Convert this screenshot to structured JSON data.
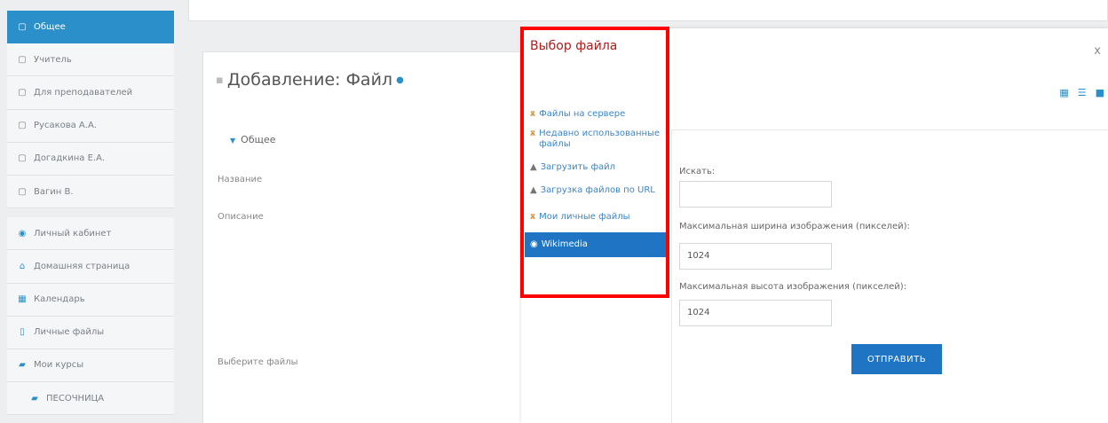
{
  "sidebar": {
    "items": [
      {
        "label": "Общее"
      },
      {
        "label": "Учитель"
      },
      {
        "label": "Для преподавателей"
      },
      {
        "label": "Русакова А.А."
      },
      {
        "label": "Догадкина Е.А."
      },
      {
        "label": "Вагин В."
      },
      {
        "label": "Личный кабинет"
      },
      {
        "label": "Домашняя страница"
      },
      {
        "label": "Календарь"
      },
      {
        "label": "Личные файлы"
      },
      {
        "label": "Мои курсы"
      },
      {
        "label": "ПЕСОЧНИЦА"
      }
    ]
  },
  "page": {
    "title": "Добавление: Файл",
    "section": "Общее",
    "fields": {
      "name": "Название",
      "description": "Описание",
      "select_files": "Выберите файлы"
    }
  },
  "modal": {
    "title": "Выбор файла",
    "close": "x",
    "repositories": [
      {
        "label": "Файлы на сервере",
        "icon": "server-icon"
      },
      {
        "label": "Недавно использованные файлы",
        "icon": "recent-icon"
      },
      {
        "label": "Загрузить файл",
        "icon": "upload-icon"
      },
      {
        "label": "Загрузка файлов по URL",
        "icon": "url-download-icon"
      },
      {
        "label": "Мои личные файлы",
        "icon": "private-files-icon"
      },
      {
        "label": "Wikimedia",
        "icon": "wikimedia-icon"
      }
    ],
    "form": {
      "search_label": "Искать:",
      "search_value": "",
      "max_width_label": "Максимальная ширина изображения (пикселей):",
      "max_width_value": "1024",
      "max_height_label": "Максимальная высота изображения (пикселей):",
      "max_height_value": "1024",
      "submit": "ОТПРАВИТЬ"
    }
  },
  "colors": {
    "accent": "#2b90c9",
    "selected": "#1f74c3",
    "modal_title": "#b11b1b",
    "highlight": "#ff0000"
  }
}
